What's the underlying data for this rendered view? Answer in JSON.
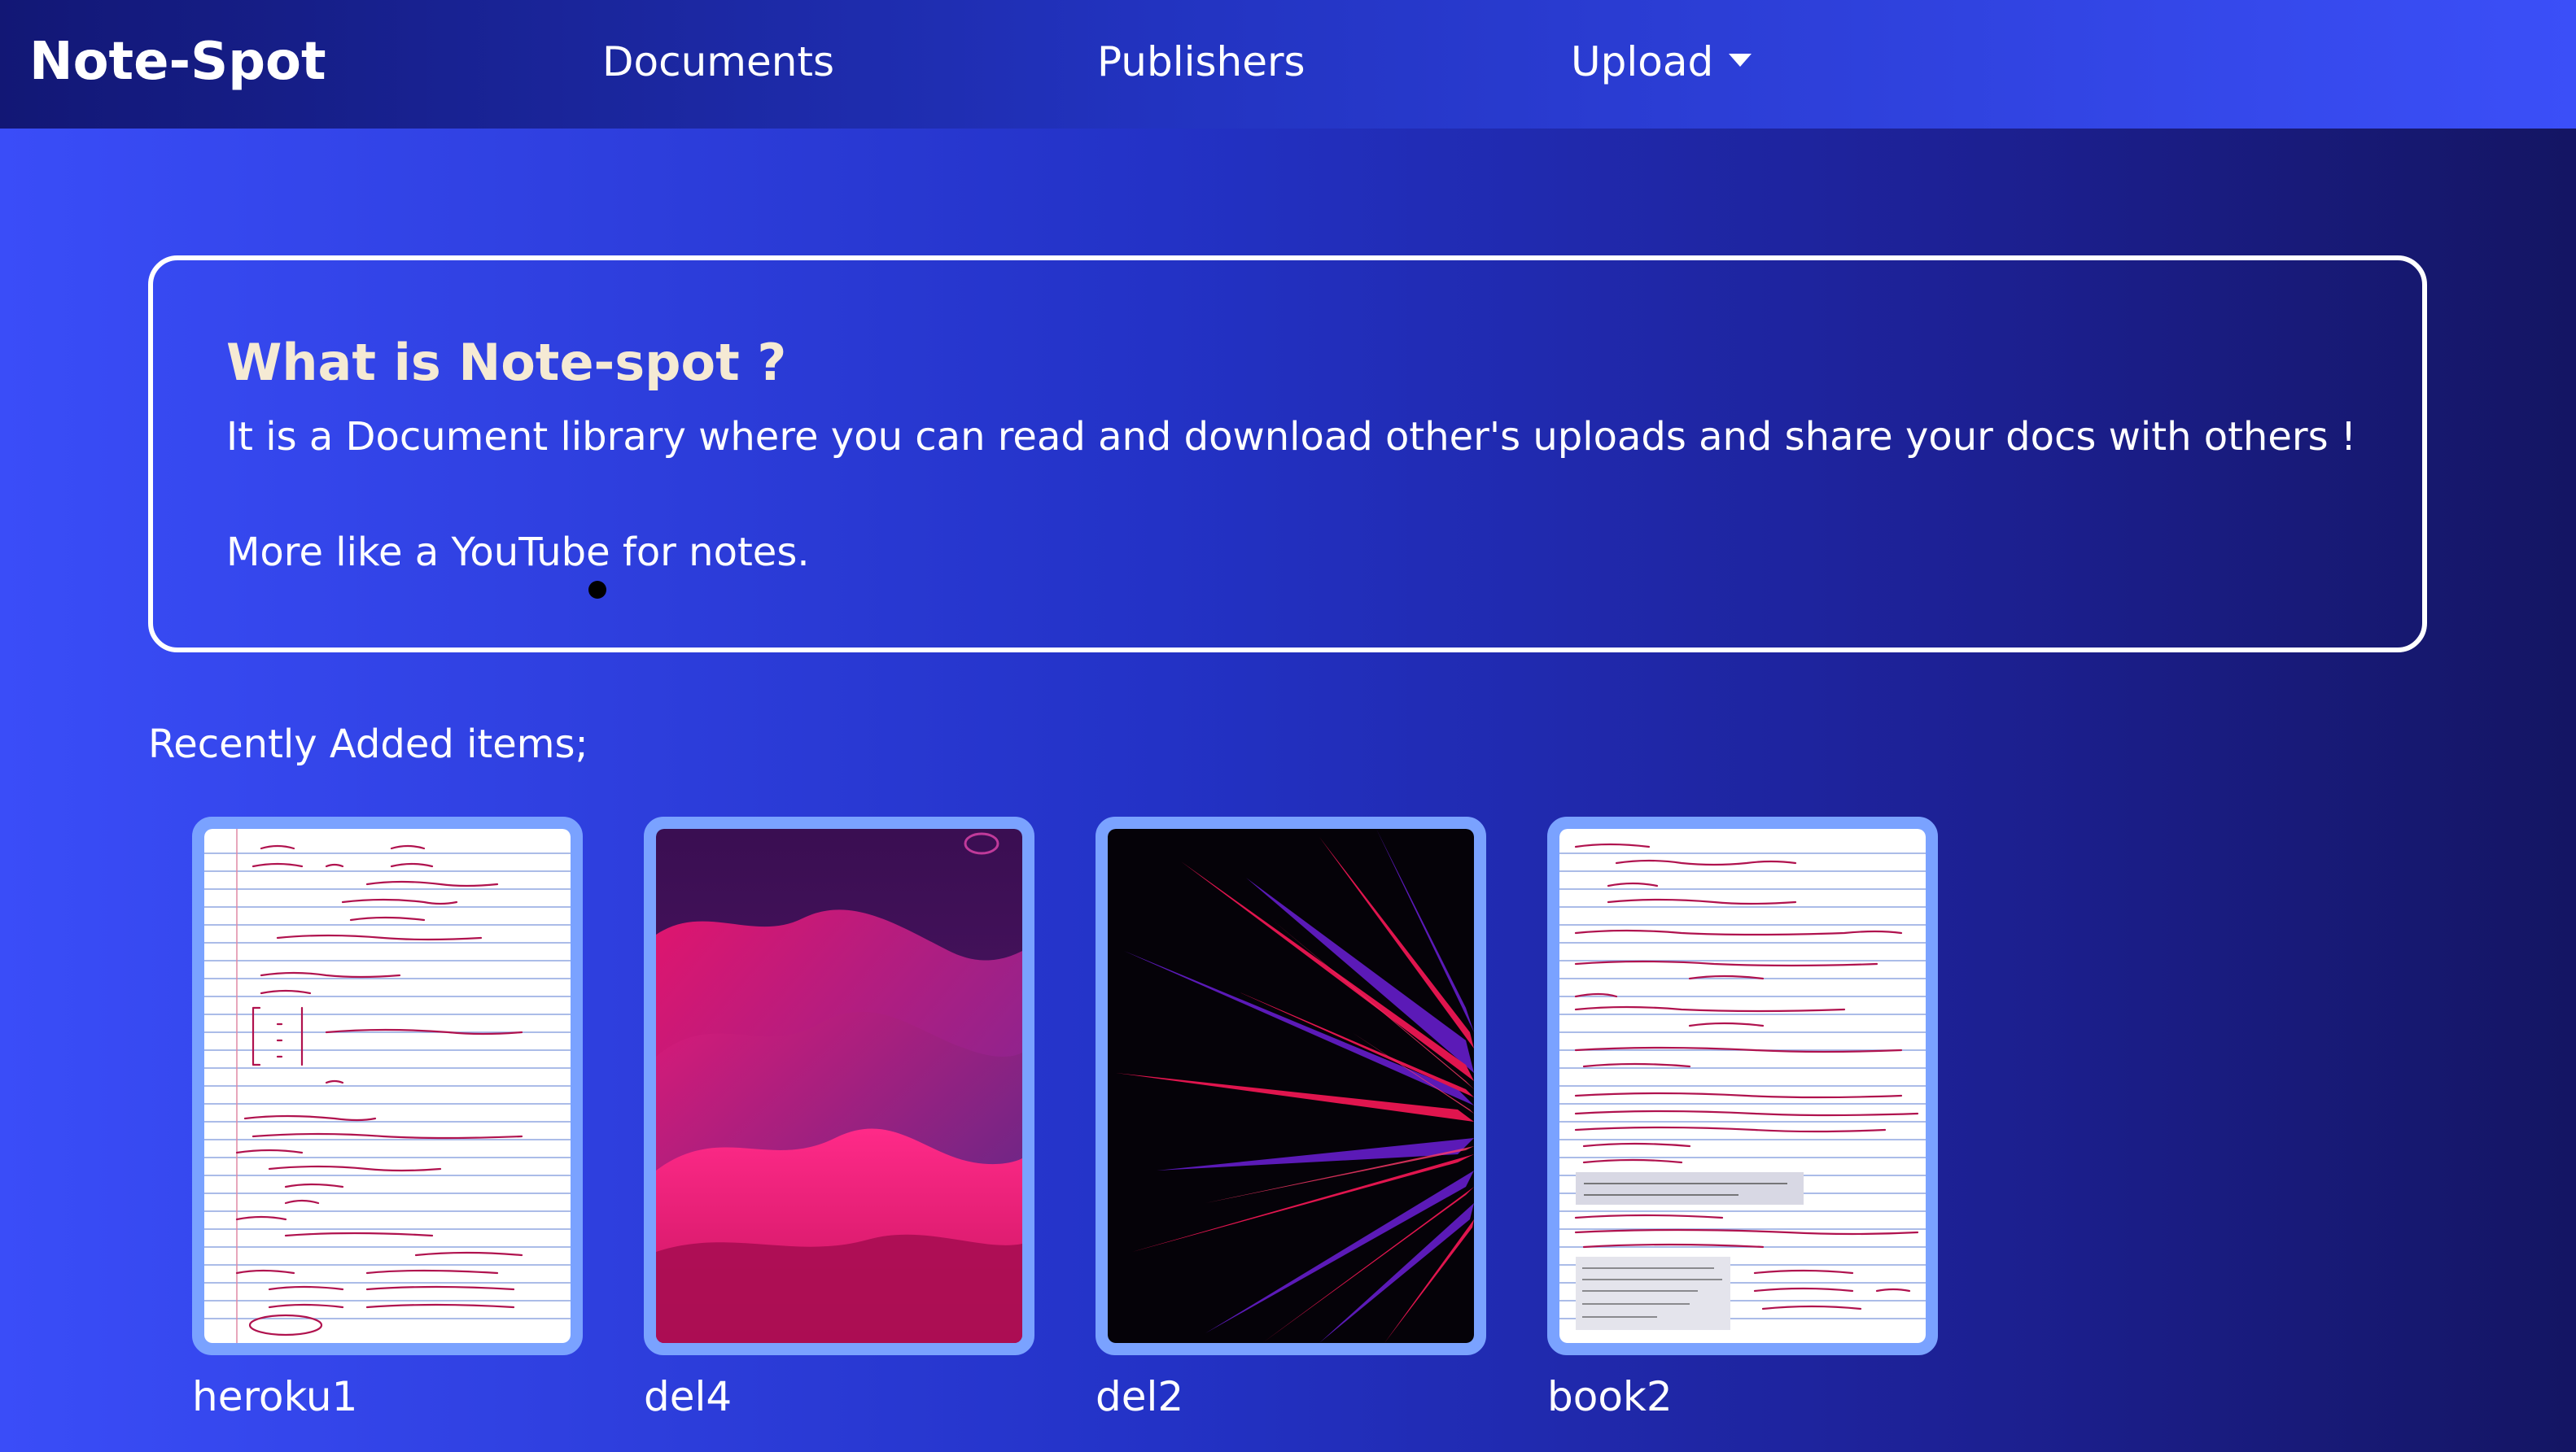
{
  "navbar": {
    "brand": "Note-Spot",
    "links": [
      "Documents",
      "Publishers",
      "Upload"
    ]
  },
  "intro": {
    "title": "What is Note-spot ?",
    "description": "It is a Document library where you can read and download other's uploads and share your docs with others !",
    "description2": "More like a YouTube for notes."
  },
  "recent": {
    "heading": "Recently Added items;",
    "items": [
      {
        "label": "heroku1",
        "thumbnail": "handwritten-notes"
      },
      {
        "label": "del4",
        "thumbnail": "pink-wave-abstract"
      },
      {
        "label": "del2",
        "thumbnail": "red-spikes-abstract"
      },
      {
        "label": "book2",
        "thumbnail": "handwritten-notes"
      }
    ]
  },
  "colors": {
    "card_border": "#7aa2ff",
    "title_text": "#f5ead4",
    "ink": "#b0124e"
  }
}
